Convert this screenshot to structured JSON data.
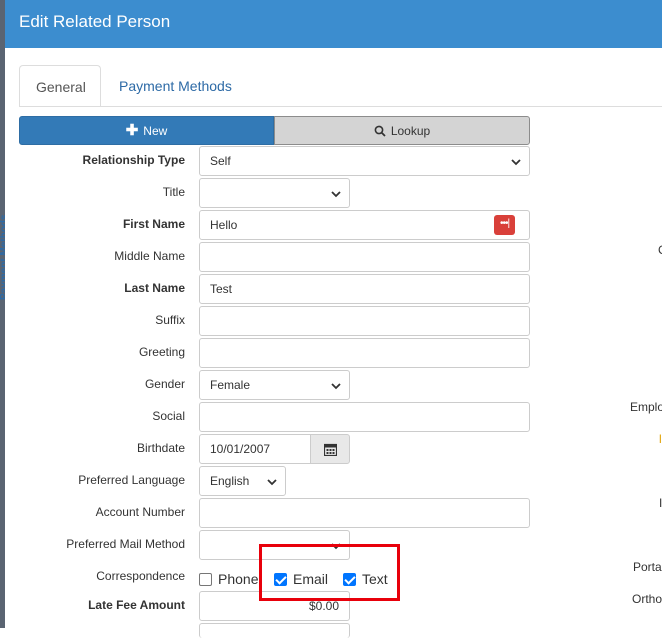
{
  "background": {
    "sidebar_text": "Payment Methods",
    "right_fragments": [
      "C",
      "Emplo",
      "I",
      "Porta",
      "Ortho"
    ]
  },
  "modal": {
    "title": "Edit Related Person",
    "header_color": "#3c8dcf"
  },
  "tabs": [
    {
      "label": "General",
      "active": true
    },
    {
      "label": "Payment Methods",
      "active": false
    }
  ],
  "toolbar": {
    "new_label": "New",
    "lookup_label": "Lookup"
  },
  "form": {
    "relationship_type": {
      "label": "Relationship Type",
      "value": "Self"
    },
    "title": {
      "label": "Title",
      "value": ""
    },
    "first_name": {
      "label": "First Name",
      "value": "Hello"
    },
    "middle_name": {
      "label": "Middle Name",
      "value": ""
    },
    "last_name": {
      "label": "Last Name",
      "value": "Test"
    },
    "suffix": {
      "label": "Suffix",
      "value": ""
    },
    "greeting": {
      "label": "Greeting",
      "value": ""
    },
    "gender": {
      "label": "Gender",
      "value": "Female"
    },
    "social": {
      "label": "Social",
      "value": ""
    },
    "birthdate": {
      "label": "Birthdate",
      "value": "10/01/2007"
    },
    "preferred_language": {
      "label": "Preferred Language",
      "value": "English"
    },
    "account_number": {
      "label": "Account Number",
      "value": ""
    },
    "preferred_mail_method": {
      "label": "Preferred Mail Method",
      "value": ""
    },
    "correspondence": {
      "label": "Correspondence",
      "options": [
        {
          "label": "Phone",
          "checked": false
        },
        {
          "label": "Email",
          "checked": true
        },
        {
          "label": "Text",
          "checked": true
        }
      ]
    },
    "late_fee_amount": {
      "label": "Late Fee Amount",
      "value": "$0.00"
    }
  },
  "colors": {
    "primary": "#337ab7",
    "password_icon": "#d9403a",
    "checkbox": "#0075ff",
    "highlight": "#e8000b"
  }
}
